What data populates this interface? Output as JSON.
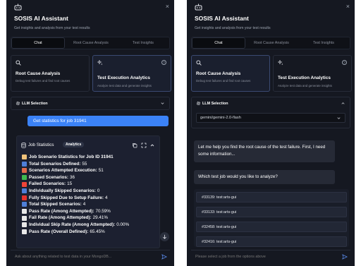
{
  "app": {
    "title": "SOSIS AI Assistant",
    "subtitle": "Get insights and analysis from your test results",
    "close": "×"
  },
  "tabs": [
    "Chat",
    "Root Cause Analysis",
    "Test Insights"
  ],
  "cards": {
    "root_cause": {
      "title": "Root Cause Analysis",
      "desc": "Debug test failures and find root causes"
    },
    "execution": {
      "title": "Test Execution Analytics",
      "desc": "Analyze test data and generate insights"
    }
  },
  "llm": {
    "label": "LLM Selection",
    "selected_model": "gemini/gemini-2.0-flash"
  },
  "left": {
    "user_message": "Get statistics for job 31941",
    "stats": {
      "title": "Job Statistics",
      "badge": "Analytics",
      "lines": [
        {
          "icon": "clipboard-icon",
          "color": "#f0c27b",
          "label": "Job Scenario Statistics for Job ID 31941",
          "value": ""
        },
        {
          "icon": "bar-chart-icon",
          "color": "#4f7fd8",
          "label": "Total Scenarios Defined:",
          "value": "55"
        },
        {
          "icon": "rocket-icon",
          "color": "#e26a4a",
          "label": "Scenarios Attempted Execution:",
          "value": "51"
        },
        {
          "icon": "check-icon",
          "color": "#3fb950",
          "label": "Passed Scenarios:",
          "value": "36"
        },
        {
          "icon": "cross-icon",
          "color": "#f04438",
          "label": "Failed Scenarios:",
          "value": "15"
        },
        {
          "icon": "skip-icon",
          "color": "#4f7fd8",
          "label": "Individually Skipped Scenarios:",
          "value": "0"
        },
        {
          "icon": "red-circle-icon",
          "color": "#e5322d",
          "label": "Fully Skipped Due to Setup Failure:",
          "value": "4"
        },
        {
          "icon": "skip-icon",
          "color": "#4f7fd8",
          "label": "Total Skipped Scenarios:",
          "value": "4"
        },
        {
          "icon": "trend-up-icon",
          "color": "#e8e8e8",
          "label": "Pass Rate (Among Attempted):",
          "value": "70.59%"
        },
        {
          "icon": "trend-down-icon",
          "color": "#e8e8e8",
          "label": "Fail Rate (Among Attempted):",
          "value": "29.41%"
        },
        {
          "icon": "trend-up-icon",
          "color": "#e8e8e8",
          "label": "Individual Skip Rate (Among Attempted):",
          "value": "0.00%"
        },
        {
          "icon": "trend-up-icon",
          "color": "#e8e8e8",
          "label": "Pass Rate (Overall Defined):",
          "value": "65.45%"
        }
      ]
    },
    "input_placeholder": "Ask about anything related to test data in your MongoDB..."
  },
  "right": {
    "bot_message_1": "Let me help you find the root cause of the test failure. First, I need some information...",
    "bot_message_2": "Which test job would you like to analyze?",
    "jobs": [
      "#33139: test:arts-gui",
      "#33133: test:arts-gui",
      "#32458: test:arts-gui",
      "#32416: test:arts-gui"
    ],
    "input_placeholder": "Please select a job from the options above"
  },
  "colors": {
    "panel_bg": "#151821",
    "accent_blue": "#3b82f6",
    "selected_card_border": "#3b4a72"
  }
}
